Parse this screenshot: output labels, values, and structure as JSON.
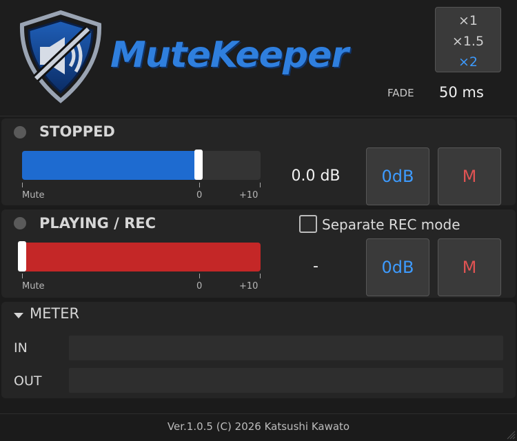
{
  "app": {
    "logo_text": "MuteKeeper",
    "brand_color": "#2f7fde"
  },
  "speed": {
    "options": [
      "×1",
      "×1.5",
      "×2"
    ],
    "selected": "×2"
  },
  "fade": {
    "label": "FADE",
    "value": "50 ms"
  },
  "stopped": {
    "title": "STOPPED",
    "led_state": "off",
    "slider_fill_fraction": 0.74,
    "scale": [
      "Mute",
      "0",
      "+10"
    ],
    "db_value": "0.0 dB",
    "zero_db_label": "0dB",
    "mute_label": "M",
    "fill_color": "#1e6bd0"
  },
  "playing": {
    "title": "PLAYING / REC",
    "led_state": "off",
    "slider_fill_fraction": 1.0,
    "thumb_position": "mute",
    "scale": [
      "Mute",
      "0",
      "+10"
    ],
    "db_value": "-",
    "zero_db_label": "0dB",
    "mute_label": "M",
    "separate_rec_label": "Separate REC mode",
    "separate_rec_checked": false,
    "fill_color": "#c42727"
  },
  "meter": {
    "title": "METER",
    "expanded": true,
    "in_label": "IN",
    "out_label": "OUT"
  },
  "footer": {
    "version": "Ver.1.0.5  (C) 2026 Katsushi Kawato"
  }
}
